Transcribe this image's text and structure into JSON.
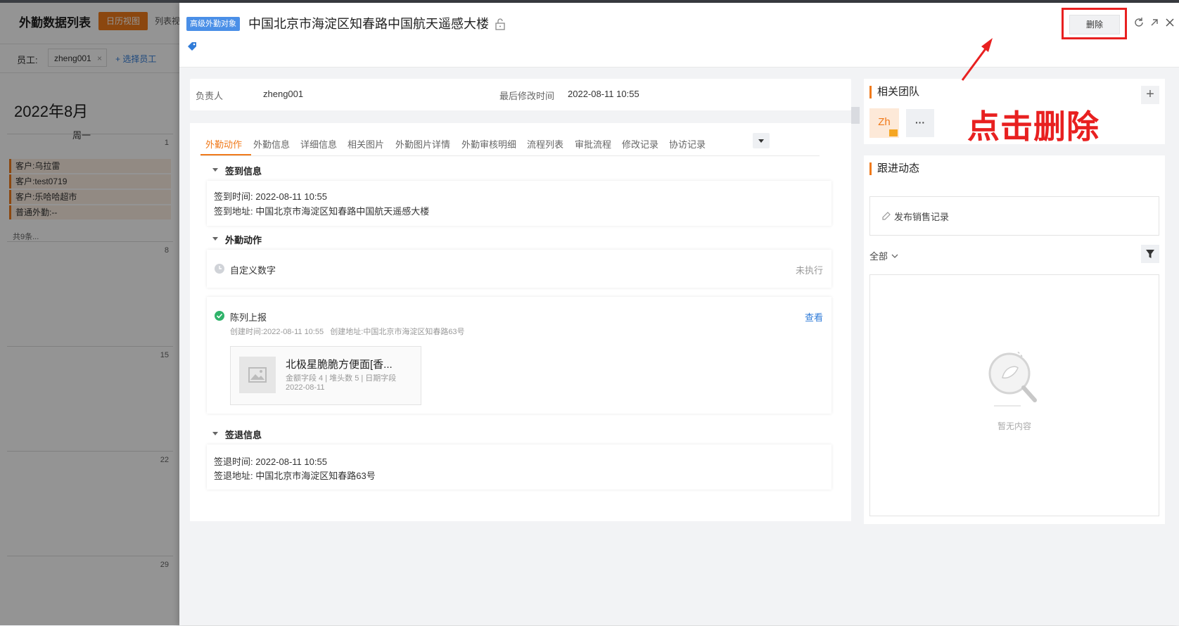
{
  "background": {
    "title": "外勤数据列表",
    "tab_calendar": "日历视图",
    "tab_list": "列表视",
    "employee_label": "员工:",
    "employee_chip": "zheng001",
    "chip_remove": "×",
    "select_employee": "+ 选择员工",
    "month": "2022年8月",
    "weekday": "周一",
    "days": [
      "1",
      "8",
      "15",
      "22",
      "29"
    ],
    "events": [
      "客户:乌拉雷",
      "客户:test0719",
      "客户:乐哈哈超市",
      "普通外勤:--"
    ],
    "more": "共9条..."
  },
  "header": {
    "object_badge": "高级外勤对象",
    "title": "中国北京市海淀区知春路中国航天遥感大楼",
    "delete_label": "删除"
  },
  "annotation": {
    "text": "点击删除"
  },
  "infobar": {
    "owner_label": "负责人",
    "owner_value": "zheng001",
    "modified_label": "最后修改时间",
    "modified_value": "2022-08-11 10:55"
  },
  "tabs": [
    "外勤动作",
    "外勤信息",
    "详细信息",
    "相关图片",
    "外勤图片详情",
    "外勤审核明细",
    "流程列表",
    "审批流程",
    "修改记录",
    "协访记录"
  ],
  "checkin": {
    "section_title": "签到信息",
    "time_label": "签到时间:",
    "time_value": "2022-08-11 10:55",
    "addr_label": "签到地址:",
    "addr_value": "中国北京市海淀区知春路中国航天遥感大楼"
  },
  "actions": {
    "section_title": "外勤动作",
    "custom_label": "自定义数字",
    "custom_status": "未执行",
    "display_label": "陈列上报",
    "view_link": "查看",
    "display_meta": "创建时间:2022-08-11 10:55   创建地址:中国北京市海淀区知春路63号",
    "product_name": "北极星脆脆方便面[香...",
    "product_fields": "金额字段 4 | 堆头数 5 | 日期字段",
    "product_date": "2022-08-11"
  },
  "checkout": {
    "section_title": "签退信息",
    "time_label": "签退时间:",
    "time_value": "2022-08-11 10:55",
    "addr_label": "签退地址:",
    "addr_value": "中国北京市海淀区知春路63号"
  },
  "team": {
    "title": "相关团队",
    "avatar": "Zh",
    "more": "···",
    "add": "+"
  },
  "followup": {
    "title": "跟进动态",
    "post_label": "发布销售记录",
    "filter_label": "全部",
    "empty_text": "暂无内容"
  },
  "colors": {
    "accent": "#f07a1b",
    "link": "#2f7bd8",
    "annotation": "#e82020",
    "success": "#2fb36a"
  }
}
